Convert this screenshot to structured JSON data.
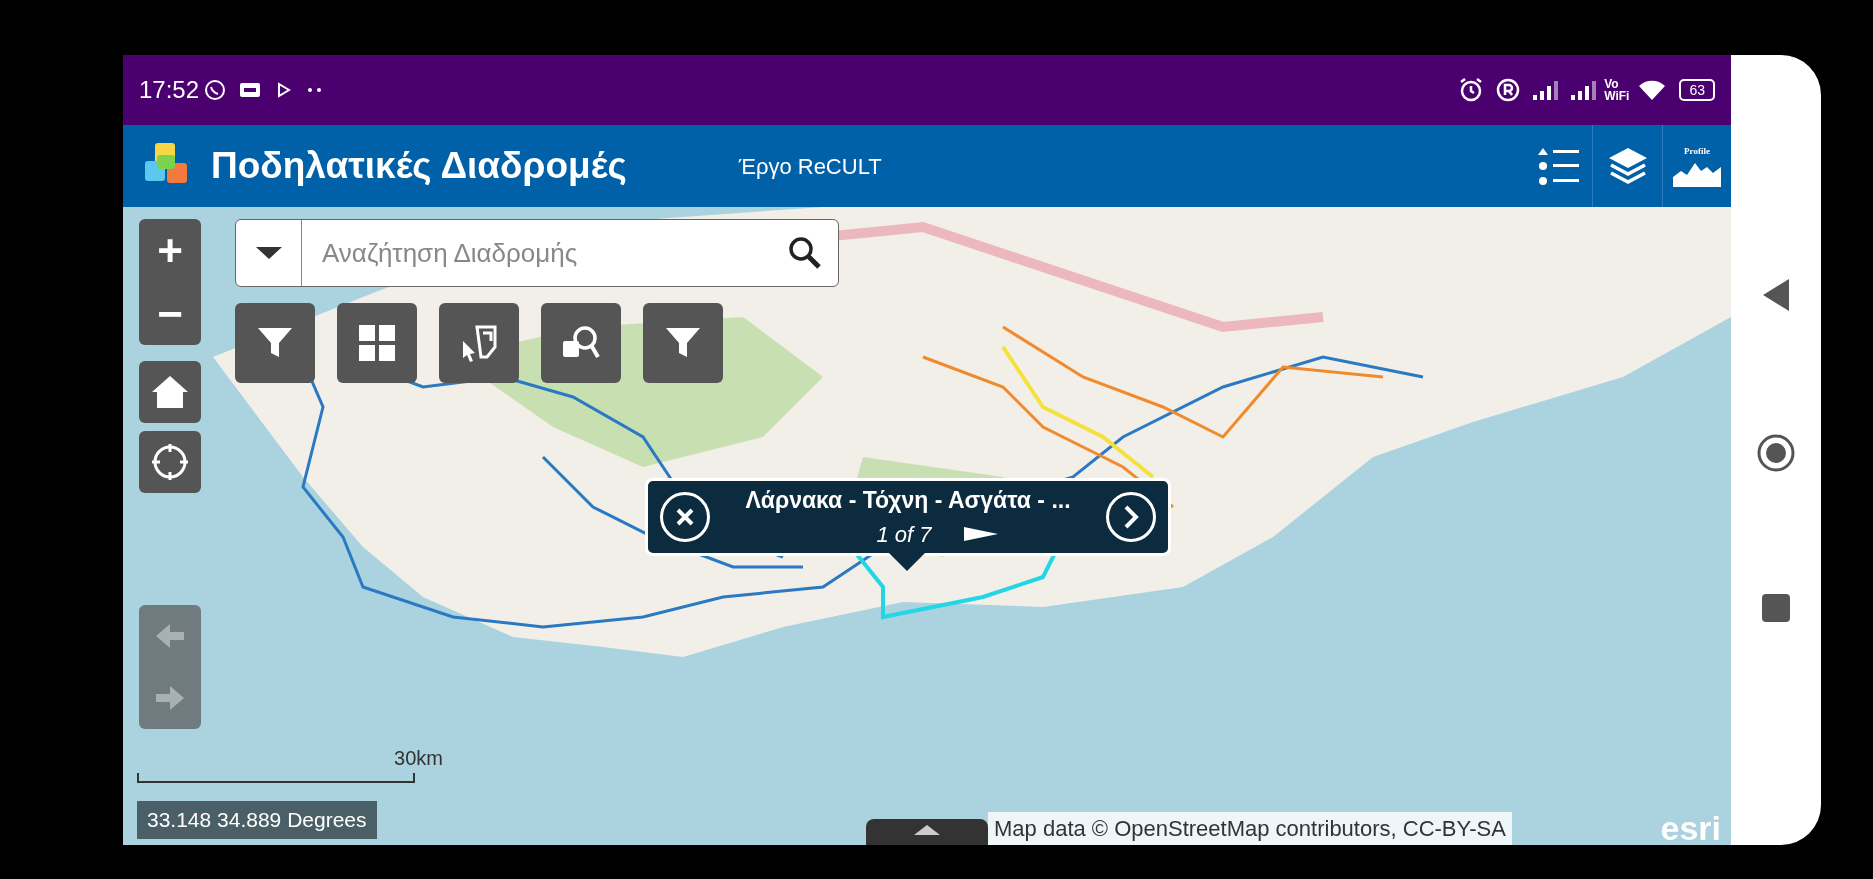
{
  "status_bar": {
    "time": "17:52",
    "network_label_top": "Vo",
    "network_label_bottom": "WiFi",
    "battery": "63"
  },
  "header": {
    "title": "Ποδηλατικές Διαδρομές",
    "subtitle": "Έργο ReCULT",
    "profile_label": "Profile"
  },
  "map_controls": {
    "zoom_in": "+",
    "zoom_out": "−",
    "history": [
      {
        "kind": "back",
        "disabled": true
      },
      {
        "kind": "forward",
        "disabled": true
      }
    ]
  },
  "search": {
    "placeholder": "Αναζήτηση Διαδρομής"
  },
  "toolbar": [
    {
      "kind": "filter"
    },
    {
      "kind": "grid"
    },
    {
      "kind": "select"
    },
    {
      "kind": "query"
    },
    {
      "kind": "filter"
    }
  ],
  "popup": {
    "title": "Λάρνακα - Τόχνη - Ασγάτα - ...",
    "counter": "1 of 7"
  },
  "scale_bar": {
    "label": "30km"
  },
  "coordinates": "33.148 34.889 Degrees",
  "attribution": "Map data © OpenStreetMap contributors, CC-BY-SA",
  "logo": "esri"
}
